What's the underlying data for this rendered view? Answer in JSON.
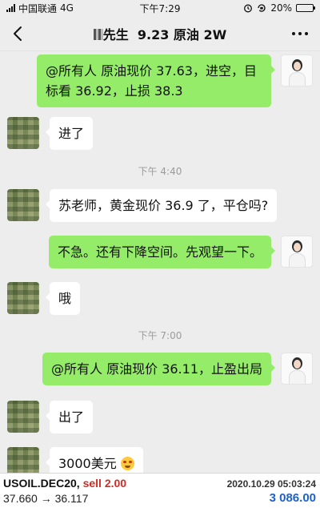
{
  "status_bar": {
    "carrier": "中国联通",
    "network": "4G",
    "time": "下午7:29",
    "battery": "20%",
    "battery_level": 0.2
  },
  "nav": {
    "title_prefix": "先生",
    "title_rest": "9.23 原油  2W"
  },
  "messages": [
    {
      "side": "right",
      "text": "@所有人  原油现价 37.63，进空，目标看 36.92，止损 38.3"
    },
    {
      "side": "left",
      "text": "进了"
    },
    {
      "type": "time",
      "text": "下午 4:40"
    },
    {
      "side": "left",
      "text": "苏老师，黄金现价 36.9 了，平仓吗?"
    },
    {
      "side": "right",
      "text": "不急。还有下降空间。先观望一下。"
    },
    {
      "side": "left",
      "text": "哦"
    },
    {
      "type": "time",
      "text": "下午 7:00"
    },
    {
      "side": "right",
      "text": "@所有人  原油现价 36.11，止盈出局"
    },
    {
      "side": "left",
      "text": "出了"
    },
    {
      "side": "left",
      "text": "3000美元",
      "emoji": "grin-emoji"
    }
  ],
  "ticker": {
    "symbol": "USOIL.DEC20,",
    "action": "sell 2.00",
    "datetime": "2020.10.29 05:03:24",
    "prices": "37.660 → 36.117",
    "profit": "3 086.00",
    "colors": {
      "sell": "#d12b23",
      "profit": "#1e62c9"
    }
  },
  "theme": {
    "background": "#ededed",
    "bubble_self": "#95ec69",
    "bubble_other": "#ffffff"
  }
}
